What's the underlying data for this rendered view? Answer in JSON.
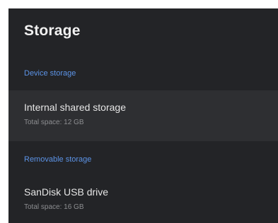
{
  "screen": {
    "title": "Storage"
  },
  "sections": [
    {
      "header": "Device storage",
      "item": {
        "title": "Internal shared storage",
        "subtitle": "Total space: 12 GB"
      }
    },
    {
      "header": "Removable storage",
      "item": {
        "title": "SanDisk USB drive",
        "subtitle": "Total space: 16 GB"
      }
    }
  ],
  "colors": {
    "background": "#232427",
    "selected_row": "#2e2f32",
    "accent": "#5c93e6",
    "primary_text": "#e6e6e6",
    "secondary_text": "#8d8e91"
  }
}
